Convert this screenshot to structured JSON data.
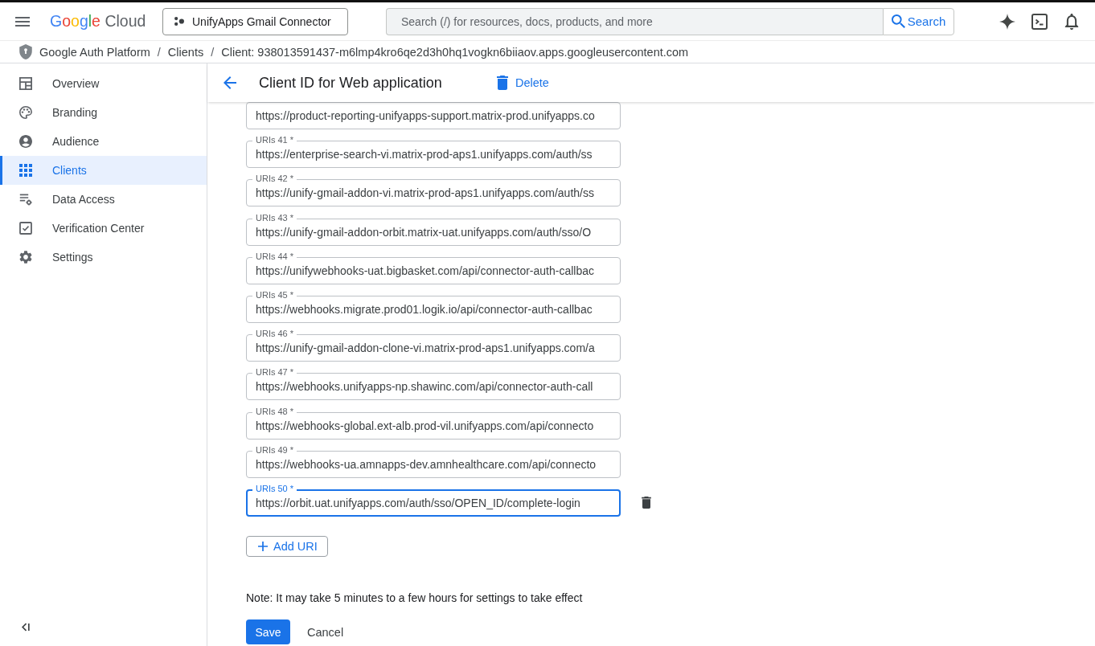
{
  "top_bar": {
    "logo": {
      "brand": "Google",
      "product": "Cloud"
    },
    "project_picker": {
      "label": "UnifyApps Gmail Connector"
    },
    "search": {
      "placeholder": "Search (/) for resources, docs, products, and more",
      "button": "Search"
    }
  },
  "breadcrumb": {
    "items": [
      "Google Auth Platform",
      "Clients",
      "Client: 938013591437-m6lmp4kro6qe2d3h0hq1vogkn6biiaov.apps.googleusercontent.com"
    ],
    "separator": "/"
  },
  "sidebar": {
    "items": [
      {
        "label": "Overview",
        "selected": false
      },
      {
        "label": "Branding",
        "selected": false
      },
      {
        "label": "Audience",
        "selected": false
      },
      {
        "label": "Clients",
        "selected": true
      },
      {
        "label": "Data Access",
        "selected": false
      },
      {
        "label": "Verification Center",
        "selected": false
      },
      {
        "label": "Settings",
        "selected": false
      }
    ]
  },
  "page_header": {
    "title": "Client ID for Web application",
    "delete_button": "Delete"
  },
  "uris": [
    {
      "value": "https://product-reporting-unifyapps-support.matrix-prod.unifyapps.co",
      "focused": false
    },
    {
      "label": "URIs 41 *",
      "value": "https://enterprise-search-vi.matrix-prod-aps1.unifyapps.com/auth/ss",
      "focused": false
    },
    {
      "label": "URIs 42 *",
      "value": "https://unify-gmail-addon-vi.matrix-prod-aps1.unifyapps.com/auth/ss",
      "focused": false
    },
    {
      "label": "URIs 43 *",
      "value": "https://unify-gmail-addon-orbit.matrix-uat.unifyapps.com/auth/sso/O",
      "focused": false
    },
    {
      "label": "URIs 44 *",
      "value": "https://unifywebhooks-uat.bigbasket.com/api/connector-auth-callbac",
      "focused": false
    },
    {
      "label": "URIs 45 *",
      "value": "https://webhooks.migrate.prod01.logik.io/api/connector-auth-callbac",
      "focused": false
    },
    {
      "label": "URIs 46 *",
      "value": "https://unify-gmail-addon-clone-vi.matrix-prod-aps1.unifyapps.com/a",
      "focused": false
    },
    {
      "label": "URIs 47 *",
      "value": "https://webhooks.unifyapps-np.shawinc.com/api/connector-auth-call",
      "focused": false
    },
    {
      "label": "URIs 48 *",
      "value": "https://webhooks-global.ext-alb.prod-vil.unifyapps.com/api/connecto",
      "focused": false
    },
    {
      "label": "URIs 49 *",
      "value": "https://webhooks-ua.amnapps-dev.amnhealthcare.com/api/connecto",
      "focused": false
    },
    {
      "label": "URIs 50 *",
      "value": "https://orbit.uat.unifyapps.com/auth/sso/OPEN_ID/complete-login",
      "focused": true
    }
  ],
  "add_uri_button": "Add URI",
  "note": "Note: It may take 5 minutes to a few hours for settings to take effect",
  "actions": {
    "save": "Save",
    "cancel": "Cancel"
  }
}
